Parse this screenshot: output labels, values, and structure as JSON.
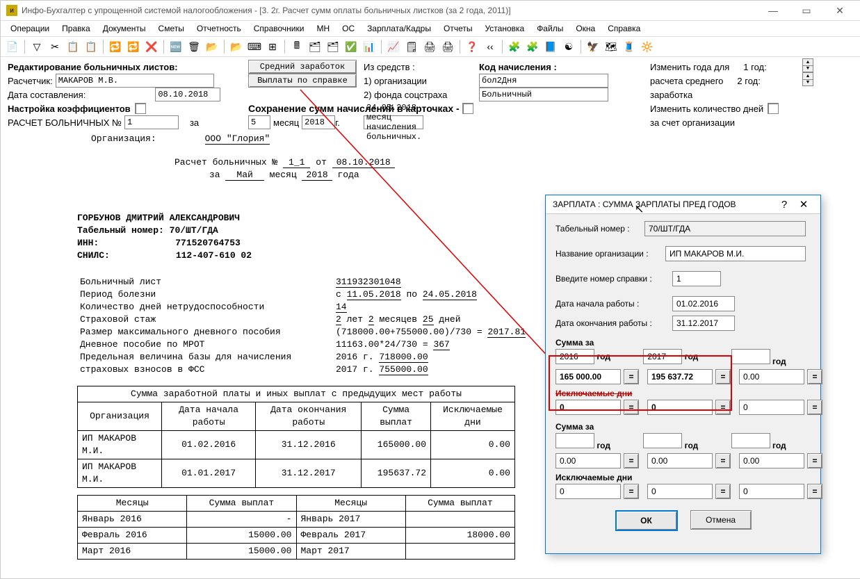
{
  "title": "Инфо-Бухгалтер с упрощенной системой налогообложения - [3. 2г. Расчет сумм оплаты больничных листков (за 2 года, 2011)]",
  "menu": [
    "Операции",
    "Правка",
    "Документы",
    "Сметы",
    "Отчетность",
    "Справочники",
    "МН",
    "ОС",
    "Зарплата/Кадры",
    "Отчеты",
    "Установка",
    "Файлы",
    "Окна",
    "Справка"
  ],
  "toolbar_icons": [
    "📄",
    "▽",
    "✂",
    "📋",
    "📋",
    "🔁",
    "🔁",
    "❌",
    "🆕",
    "🗑",
    "📂",
    "📂",
    "⌨",
    "⊞",
    "🖩",
    "🗂",
    "🗂",
    "✅",
    "📊",
    "📈",
    "🗒",
    "🖨",
    "🖨",
    "❓",
    "‹‹",
    "🧩",
    "🧩",
    "📘",
    "☯",
    "🦅",
    "🗺",
    "🧵",
    "🔆"
  ],
  "hdr": {
    "edit_label": "Редактирование больничных листов:",
    "calc_label": "Расчетчик:",
    "calc_val": "МАКАРОВ М.В.",
    "date_label": "Дата составления:",
    "date_val": "08.10.2018",
    "coef_label": "Настройка коэффициентов",
    "calc_no_label": "РАСЧЕТ БОЛЬНИЧНЫХ №",
    "calc_no": "1",
    "za": "за",
    "month_no": "5",
    "mes": "месяц",
    "year": "2018",
    "g": "г.",
    "btn_avg": "Средний заработок",
    "btn_ref": "Выплаты по справке",
    "src_lbl": "Из средств :",
    "src1": "1) организации",
    "src2": "2) фонда соцстраха",
    "code_lbl": "Код начисления :",
    "code1": "бол2Дня",
    "code2": "Больничный",
    "save_lbl": "Сохранение сумм начислений в карточках -",
    "save_date": "24.05.2018 месяц начисления больничных.",
    "chg_year_l1": "Изменить года для",
    "chg_year_l2": "расчета среднего",
    "chg_year_l3": "заработка",
    "y1": "1 год:",
    "y2": "2 год:",
    "chg_days1": "Изменить количество дней",
    "chg_days2": "за счет организации"
  },
  "sheet": {
    "org_l": "Организация:",
    "org_v": "ООО \"Глория\"",
    "calc_l": "Расчет больничных №",
    "calc_v": "1_1",
    "ot": "от",
    "date": "08.10.2018",
    "za": "за",
    "month": "Май",
    "mes": "месяц",
    "year": "2018",
    "goda": "года",
    "name": "ГОРБУНОВ ДМИТРИЙ АЛЕКСАНДРОВИЧ",
    "tab_l": "Табельный номер:",
    "tab_v": "70/ШТ/ГДА",
    "inn_l": "ИНН:",
    "inn_v": "771520764753",
    "snils_l": "СНИЛС:",
    "snils_v": "112-407-610 02",
    "bl_l": "Больничный лист",
    "bl_v": "311932301048",
    "period_l": "Период болезни",
    "c": "с",
    "d1": "11.05.2018",
    "po": "по",
    "d2": "24.05.2018",
    "days_l": "Количество дней нетрудоспособности",
    "days_v": "14",
    "exp_l": "Страховой стаж",
    "ey": "2",
    "let": "лет",
    "em": "2",
    "mes2": "месяцев",
    "ed": "25",
    "dney": "дней",
    "max_l": "Размер максимального дневного пособия",
    "max_v": "(718000.00+755000.00)/730 = ",
    "max_v2": "2017.81",
    "mrot_l": "Дневное пособие по МРОТ",
    "mrot_v": "11163.00*24/730 = ",
    "mrot_v2": "367",
    "base_l": "Предельная величина базы для начисления страховых взносов в ФСС",
    "b16": "2016 г.",
    "b16v": "718000.00",
    "b17": "2017 г.",
    "b17v": "755000.00",
    "t1_cap": "Сумма заработной платы и иных выплат с предыдущих мест работы",
    "t1_h": [
      "Организация",
      "Дата начала работы",
      "Дата окончания работы",
      "Сумма выплат",
      "Исключаемые дни"
    ],
    "t1_r": [
      [
        "ИП МАКАРОВ М.И.",
        "01.02.2016",
        "31.12.2016",
        "165000.00",
        "0.00"
      ],
      [
        "ИП МАКАРОВ М.И.",
        "01.01.2017",
        "31.12.2017",
        "195637.72",
        "0.00"
      ]
    ],
    "t2_h": [
      "Месяцы",
      "Сумма выплат",
      "Месяцы",
      "Сумма выплат"
    ],
    "t2_r": [
      [
        "Январь 2016",
        "-",
        "Январь 2017",
        ""
      ],
      [
        "Февраль 2016",
        "15000.00",
        "Февраль 2017",
        "18000.00"
      ],
      [
        "Март 2016",
        "15000.00",
        "Март 2017",
        ""
      ]
    ]
  },
  "dialog": {
    "title": "ЗАРПЛАТА : СУММА ЗАРПЛАТЫ ПРЕД ГОДОВ",
    "tab_l": "Табельный номер :",
    "tab_v": "70/ШТ/ГДА",
    "org_l": "Название организации  :",
    "org_v": "ИП МАКАРОВ М.И.",
    "ref_l": "Введите номер справки   :",
    "ref_v": "1",
    "ds_l": "Дата начала работы    :",
    "ds_v": "01.02.2016",
    "de_l": "Дата окончания работы  :",
    "de_v": "31.12.2017",
    "sum_l": "Сумма за",
    "y": "год",
    "y1": "2016",
    "v1": "165 000.00",
    "y2": "2017",
    "v2": "195 637.72",
    "y3": "",
    "v3": "0.00",
    "ex_l": "Исключаемые дни",
    "ex1": "0",
    "ex2": "0",
    "ex3": "0",
    "sum2_l": "Сумма за",
    "r2v1": "0.00",
    "r2v2": "0.00",
    "r2v3": "0.00",
    "ex2_l": "Исключаемые дни",
    "e2v1": "0",
    "e2v2": "0",
    "e2v3": "0",
    "ok": "ОК",
    "cancel": "Отмена"
  }
}
